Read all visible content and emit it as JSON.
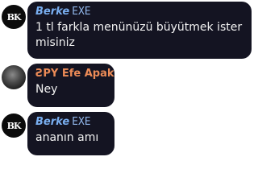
{
  "messages": [
    {
      "avatar_text": "BK",
      "sender": "Berke",
      "sender_suffix": "EXE",
      "text": "1 tl farkla menünüzü büyütmek ister misiniz"
    },
    {
      "avatar_text": "",
      "sender": "ƧPY Efe Apak",
      "sender_suffix": "",
      "text": "Ney"
    },
    {
      "avatar_text": "BK",
      "sender": "Berke",
      "sender_suffix": "EXE",
      "text": "ananın amı"
    }
  ],
  "colors": {
    "bubble": "#141422",
    "name_blue": "#79aef0",
    "name_orange": "#ec8b57",
    "text": "#f2f2f2"
  }
}
